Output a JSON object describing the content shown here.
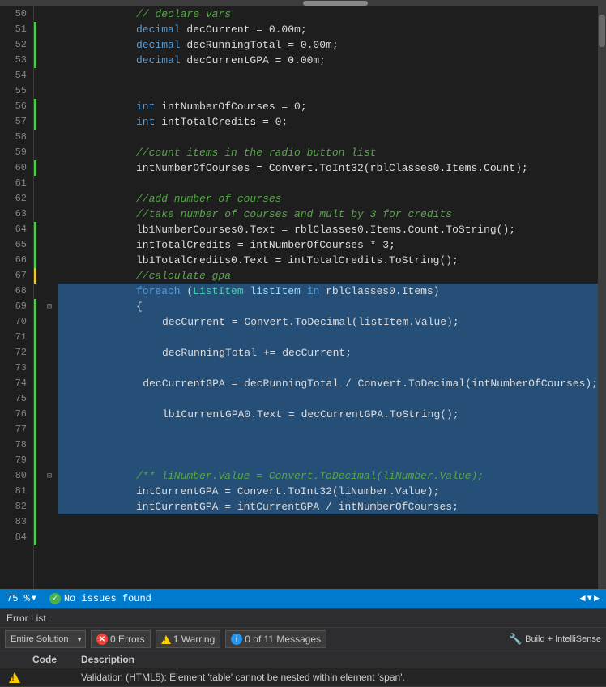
{
  "editor": {
    "scrollbar": {},
    "lines": [
      {
        "num": 50,
        "indent": 3,
        "tokens": [
          {
            "t": "cm",
            "v": "// declare vars"
          }
        ]
      },
      {
        "num": 51,
        "indent": 3,
        "tokens": [
          {
            "t": "kw",
            "v": "decimal"
          },
          {
            "t": "plain",
            "v": " decCurrent = 0.00m;"
          }
        ]
      },
      {
        "num": 52,
        "indent": 3,
        "tokens": [
          {
            "t": "kw",
            "v": "decimal"
          },
          {
            "t": "plain",
            "v": " decRunningTotal = 0.00m;"
          }
        ]
      },
      {
        "num": 53,
        "indent": 3,
        "tokens": [
          {
            "t": "kw",
            "v": "decimal"
          },
          {
            "t": "plain",
            "v": " decCurrentGPA = 0.00m;"
          }
        ]
      },
      {
        "num": 54,
        "indent": 3,
        "tokens": []
      },
      {
        "num": 55,
        "indent": 3,
        "tokens": []
      },
      {
        "num": 56,
        "indent": 3,
        "tokens": [
          {
            "t": "kw",
            "v": "int"
          },
          {
            "t": "plain",
            "v": " intNumberOfCourses = 0;"
          }
        ]
      },
      {
        "num": 57,
        "indent": 3,
        "tokens": [
          {
            "t": "kw",
            "v": "int"
          },
          {
            "t": "plain",
            "v": " intTotalCredits = 0;"
          }
        ]
      },
      {
        "num": 58,
        "indent": 3,
        "tokens": []
      },
      {
        "num": 59,
        "indent": 3,
        "tokens": [
          {
            "t": "cm",
            "v": "//count items in the radio button list"
          }
        ]
      },
      {
        "num": 60,
        "indent": 3,
        "tokens": [
          {
            "t": "plain",
            "v": "intNumberOfCourses = Convert.ToInt32(rblClasses0.Items.Count);"
          }
        ]
      },
      {
        "num": 61,
        "indent": 3,
        "tokens": []
      },
      {
        "num": 62,
        "indent": 3,
        "tokens": [
          {
            "t": "cm",
            "v": "//add number of courses"
          }
        ]
      },
      {
        "num": 63,
        "indent": 3,
        "tokens": [
          {
            "t": "cm",
            "v": "//take number of courses and mult by 3 for credits"
          }
        ]
      },
      {
        "num": 64,
        "indent": 3,
        "tokens": [
          {
            "t": "plain",
            "v": "lb1NumberCourses0.Text = rblClasses0.Items.Count.ToString();"
          }
        ]
      },
      {
        "num": 65,
        "indent": 3,
        "tokens": [
          {
            "t": "plain",
            "v": "intTotalCredits = intNumberOfCourses * 3;"
          }
        ]
      },
      {
        "num": 66,
        "indent": 3,
        "tokens": [
          {
            "t": "plain",
            "v": "lb1TotalCredits0.Text = intTotalCredits.ToString();"
          }
        ]
      },
      {
        "num": 67,
        "indent": 3,
        "tokens": [],
        "glyph": true
      },
      {
        "num": 68,
        "indent": 3,
        "tokens": [
          {
            "t": "cm",
            "v": "//calculate gpa"
          }
        ]
      },
      {
        "num": 69,
        "indent": 3,
        "highlighted": true,
        "tokens": [
          {
            "t": "kw",
            "v": "foreach"
          },
          {
            "t": "plain",
            "v": " ("
          },
          {
            "t": "type",
            "v": "ListItem"
          },
          {
            "t": "plain",
            "v": " "
          },
          {
            "t": "var",
            "v": "listItem"
          },
          {
            "t": "plain",
            "v": " "
          },
          {
            "t": "kw",
            "v": "in"
          },
          {
            "t": "plain",
            "v": " rblClasses0.Items)"
          }
        ],
        "expand": true
      },
      {
        "num": 70,
        "indent": 3,
        "highlighted": true,
        "tokens": [
          {
            "t": "plain",
            "v": "{"
          }
        ]
      },
      {
        "num": 71,
        "indent": 4,
        "highlighted": true,
        "tokens": [
          {
            "t": "plain",
            "v": "decCurrent = Convert.ToDecimal(listItem.Value);"
          }
        ]
      },
      {
        "num": 72,
        "indent": 4,
        "highlighted": true,
        "tokens": []
      },
      {
        "num": 73,
        "indent": 4,
        "highlighted": true,
        "tokens": [
          {
            "t": "plain",
            "v": "decRunningTotal += decCurrent;"
          }
        ]
      },
      {
        "num": 74,
        "indent": 4,
        "highlighted": true,
        "tokens": []
      },
      {
        "num": 75,
        "indent": 4,
        "highlighted": true,
        "tokens": [
          {
            "t": "plain",
            "v": "decCurrentGPA = decRunningTotal / Convert.ToDecimal(intNumberOfCourses);"
          }
        ]
      },
      {
        "num": 76,
        "indent": 4,
        "highlighted": true,
        "tokens": []
      },
      {
        "num": 77,
        "indent": 4,
        "highlighted": true,
        "tokens": [
          {
            "t": "plain",
            "v": "lb1CurrentGPA0.Text = decCurrentGPA.ToString();"
          }
        ]
      },
      {
        "num": 78,
        "indent": 3,
        "highlighted": true,
        "tokens": []
      },
      {
        "num": 79,
        "indent": 3,
        "highlighted": true,
        "tokens": []
      },
      {
        "num": 80,
        "indent": 3,
        "highlighted": true,
        "tokens": []
      },
      {
        "num": 81,
        "indent": 3,
        "highlighted": true,
        "tokens": [
          {
            "t": "cm",
            "v": "/** liNumber.Value = Convert.ToDecimal(liNumber.Value);"
          }
        ],
        "expand": true
      },
      {
        "num": 82,
        "indent": 3,
        "highlighted": true,
        "tokens": [
          {
            "t": "plain",
            "v": "intCurrentGPA = Convert.ToInt32(liNumber.Value);"
          }
        ]
      },
      {
        "num": 83,
        "indent": 3,
        "highlighted": true,
        "tokens": [
          {
            "t": "plain",
            "v": "intCurrentGPA = intCurrentGPA / intNumberOfCourses;"
          }
        ]
      }
    ]
  },
  "status_bar": {
    "zoom": "75 %",
    "zoom_arrow": "▼",
    "status_text": "No issues found",
    "nav_back": "◄",
    "nav_fwd": "►",
    "nav_down": "▼"
  },
  "error_list": {
    "header": "Error List",
    "scope_label": "Entire Solution",
    "errors_count": "0 Errors",
    "warnings_count": "1 Warring",
    "messages_count": "0 of 11 Messages",
    "build_label": "Build + IntelliSense",
    "columns": {
      "code": "Code",
      "description": "Description"
    },
    "rows": [
      {
        "severity": "warning",
        "code": "",
        "description": "Validation (HTML5): Element 'table' cannot be nested within element 'span'."
      }
    ]
  }
}
